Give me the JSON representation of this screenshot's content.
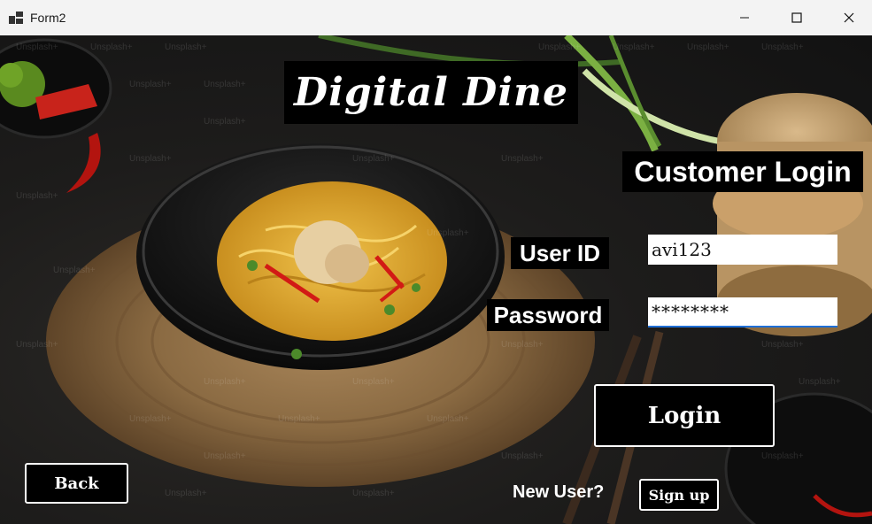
{
  "window": {
    "title": "Form2",
    "controls": {
      "minimize": "minimize",
      "maximize": "maximize",
      "close": "close"
    }
  },
  "brand": {
    "title": "Digital Dine"
  },
  "login": {
    "heading": "Customer Login",
    "userid_label": "User ID",
    "userid_value": "avi123",
    "password_label": "Password",
    "password_value": "********",
    "login_button": "Login"
  },
  "footer": {
    "back_button": "Back",
    "new_user_label": "New User?",
    "signup_button": "Sign up"
  },
  "background": {
    "watermark_text": "Unsplash+",
    "description_colors": {
      "plate": "#111111",
      "mat": "#9c7a4e",
      "noodles": "#e6b13a",
      "pepper": "#c41a1a"
    }
  },
  "colors": {
    "title_bar": "#f3f3f3",
    "label_bg": "#000000",
    "label_fg": "#ffffff",
    "focus_underline": "#1f6fd6"
  }
}
